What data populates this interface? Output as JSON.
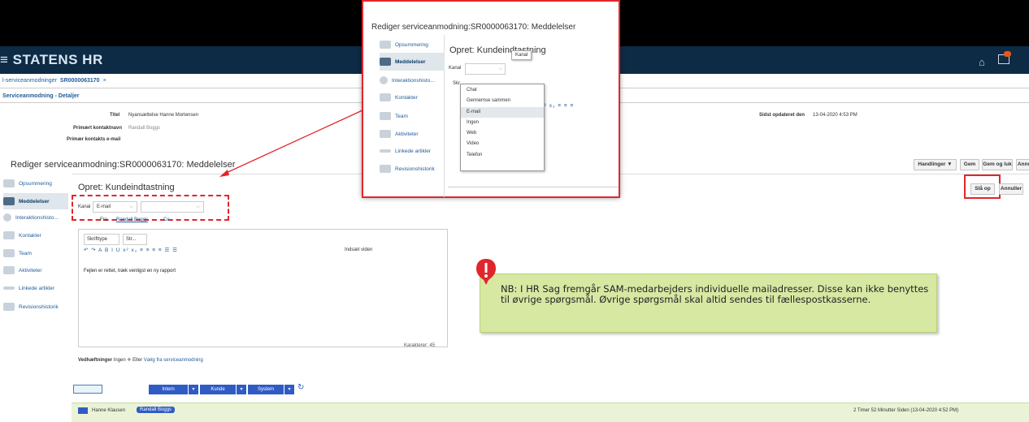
{
  "brand": "≡ STATENS HR",
  "tabs": {
    "t1": "l-serviceanmodninger",
    "t2": "SR0000063170",
    "close": "×"
  },
  "subtab": "Serviceanmodning - Detaljer",
  "header": {
    "title_label": "Titel",
    "title_value": "Nyansættelse Hanne Mortensen",
    "contact_label": "Primært kontaktnavn",
    "contact_value": "Randall Boggs",
    "email_label": "Primær kontakts e-mail",
    "updated_label": "Sidst opdateret den",
    "updated_value": "13-04-2020 4:53 PM"
  },
  "page_title": "Rediger serviceanmodning:SR0000063170: Meddelelser",
  "actions": {
    "handlinger": "Handlinger ▼",
    "gem": "Gem",
    "gem_luk": "Gem og luk",
    "annuller": "Annuller",
    "slaa_op": "Slå op",
    "annuller2": "Annuller"
  },
  "nav": [
    "Opsummering",
    "Meddelelser",
    "Interaktionshisto...",
    "Kontakter",
    "Team",
    "Aktiviteter",
    "Linkede artikler",
    "Revisionshistorik"
  ],
  "form": {
    "title": "Opret: Kundeindtastning",
    "kanal_label": "Kanal",
    "kanal_value": "E-mail",
    "fra_label": "Fra",
    "fra_value": "Randall Boggs",
    "cc": "Cc",
    "font_type": "Skrifttype",
    "font_size": "Str...",
    "insert": "Indsæt viden",
    "body": "Fejlen er rettet, træk venligst en ny rapport",
    "chars": "Karakterer: 45",
    "attach_label": "Vedhæftninger",
    "attach_none": "Ingen",
    "attach_or": "Eller",
    "attach_link": "Vælg fra serviceanmodning"
  },
  "filters": {
    "intern": "Intern",
    "kunde": "Kunde",
    "system": "System"
  },
  "message": {
    "from": "Hanne Klausen",
    "to": "Randall Boggs",
    "time": "2 Timer 52 Minutter Siden (13-04-2020 4:52 PM)"
  },
  "popup": {
    "title": "Rediger serviceanmodning:SR0000063170: Meddelelser",
    "form_title": "Opret: Kundeindtastning",
    "kanal_label": "Kanal",
    "tooltip": "Kanal",
    "skr": "Skr",
    "nav": [
      "Opsummering",
      "Meddelelser",
      "Interaktionshisto...",
      "Kontakter",
      "Team",
      "Aktiviteter",
      "Linkede artikler",
      "Revisionshistorik"
    ],
    "options": [
      "Chat",
      "Gennemse sammen",
      "E-mail",
      "Ingen",
      "Web",
      "Video",
      "Telefon"
    ]
  },
  "note": "NB: I HR Sag fremgår SAM-medarbejders individuelle mailadresser. Disse kan ikke benyttes til øvrige spørgsmål. Øvrige spørgsmål skal altid sendes til fællespostkasserne.",
  "colors": {
    "brand_bar": "#0d2b44",
    "highlight": "#e1262b",
    "note_bg": "#d7e8a3",
    "filter_btn": "#2f5cc4"
  }
}
